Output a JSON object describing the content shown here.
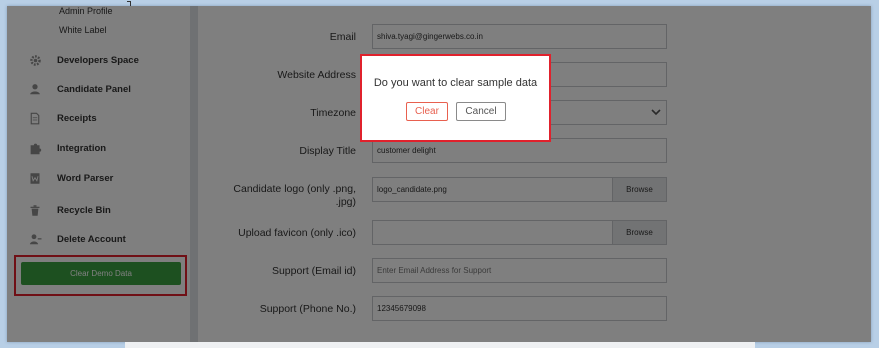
{
  "sidebar": {
    "sub_items": [
      "Admin Profile",
      "White Label"
    ],
    "items": [
      {
        "label": "Developers Space",
        "icon": "gear-icon"
      },
      {
        "label": "Candidate Panel",
        "icon": "person-icon"
      },
      {
        "label": "Receipts",
        "icon": "document-icon"
      },
      {
        "label": "Integration",
        "icon": "puzzle-icon"
      },
      {
        "label": "Word Parser",
        "icon": "word-file-icon"
      },
      {
        "label": "Recycle Bin",
        "icon": "trash-icon"
      },
      {
        "label": "Delete Account",
        "icon": "user-remove-icon"
      }
    ],
    "clear_demo_label": "Clear Demo Data"
  },
  "form": {
    "email": {
      "label": "Email",
      "value": "shiva.tyagi@gingerwebs.co.in"
    },
    "website": {
      "label": "Website Address",
      "value": ""
    },
    "timezone": {
      "label": "Timezone",
      "value": ""
    },
    "display_title": {
      "label": "Display Title",
      "value": "customer delight"
    },
    "candidate_logo": {
      "label": "Candidate logo (only .png, .jpg)",
      "value": "logo_candidate.png",
      "browse": "Browse"
    },
    "favicon": {
      "label": "Upload favicon (only .ico)",
      "value": "",
      "browse": "Browse"
    },
    "support_email": {
      "label": "Support (Email id)",
      "placeholder": "Enter Email Address for Support"
    },
    "support_phone": {
      "label": "Support (Phone No.)",
      "value": "12345679098"
    }
  },
  "dialog": {
    "message": "Do you want to clear sample data",
    "clear_label": "Clear",
    "cancel_label": "Cancel"
  },
  "colors": {
    "accent_green": "#3aa141",
    "highlight_red": "#e0212c",
    "clear_button": "#e8604f"
  }
}
